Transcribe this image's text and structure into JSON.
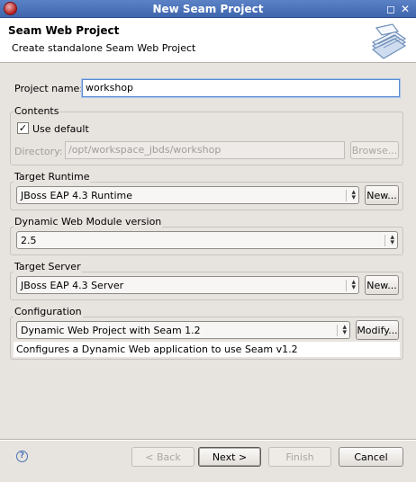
{
  "window": {
    "title": "New Seam Project"
  },
  "banner": {
    "title": "Seam Web Project",
    "description": "Create standalone Seam Web Project"
  },
  "project_name": {
    "label": "Project name:",
    "value": "workshop"
  },
  "contents": {
    "group_label": "Contents",
    "use_default_label": "Use default",
    "use_default_checked": true,
    "directory_label": "Directory:",
    "directory_value": "/opt/workspace_jbds/workshop",
    "browse_label": "Browse..."
  },
  "target_runtime": {
    "group_label": "Target Runtime",
    "selected": "JBoss EAP 4.3 Runtime",
    "new_label": "New..."
  },
  "module_version": {
    "group_label": "Dynamic Web Module version",
    "selected": "2.5"
  },
  "target_server": {
    "group_label": "Target Server",
    "selected": "JBoss EAP 4.3 Server",
    "new_label": "New..."
  },
  "configuration": {
    "group_label": "Configuration",
    "selected": "Dynamic Web Project with Seam 1.2",
    "modify_label": "Modify...",
    "description": "Configures a Dynamic Web application to use Seam v1.2"
  },
  "footer": {
    "back_label": "< Back",
    "next_label": "Next >",
    "finish_label": "Finish",
    "cancel_label": "Cancel"
  },
  "icons": {
    "app": "eclipse-app-icon",
    "banner": "seam-wizard-graphic",
    "help": "help-icon",
    "checkbox": "checkbox-checked"
  }
}
